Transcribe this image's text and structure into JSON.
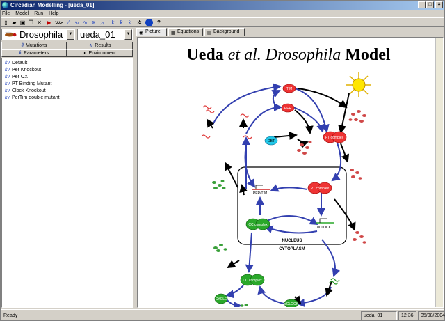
{
  "window": {
    "title": "Circadian Modelling - [ueda_01]"
  },
  "menu": [
    "File",
    "Model",
    "Run",
    "Help"
  ],
  "sidebar": {
    "model_select": "Drosophila",
    "version_select": "ueda_01",
    "tabs": [
      {
        "label": "Mutations",
        "icon": "mutations-icon"
      },
      {
        "label": "Results",
        "icon": "results-icon"
      },
      {
        "label": "Parameters",
        "icon": "parameters-icon"
      },
      {
        "label": "Environment",
        "icon": "environment-icon"
      }
    ],
    "items": [
      {
        "label": "Default"
      },
      {
        "label": "Per Knockout"
      },
      {
        "label": "Per OX"
      },
      {
        "label": "PT Binding Mutant"
      },
      {
        "label": "Clock Knockout"
      },
      {
        "label": "PerTim double mutant"
      }
    ]
  },
  "view_tabs": [
    {
      "label": "Picture"
    },
    {
      "label": "Equations"
    },
    {
      "label": "Background"
    }
  ],
  "diagram": {
    "title_pre": "Ueda ",
    "title_italic": "et al. Drosophila",
    "title_post": " Model",
    "nodes": {
      "tim": "TIM",
      "per": "PER",
      "dbt": "DBT",
      "pt_complex": "PT complex",
      "pt_complex_nuc": "PT complex",
      "per_tim_gene": "PER/TIM",
      "cc_complex_nuc": "CC complex",
      "dclock_gene": "dCLOCK",
      "cc_complex_cyto": "CC complex",
      "cycle": "CYCLE",
      "dclock": "dCLOCK"
    },
    "nucleus_label": "NUCLEUS",
    "cytoplasm_label": "CYTOPLASM"
  },
  "status": {
    "text": "Ready",
    "model": "ueda_01",
    "time": "12:36",
    "date": "05/08/2004"
  }
}
